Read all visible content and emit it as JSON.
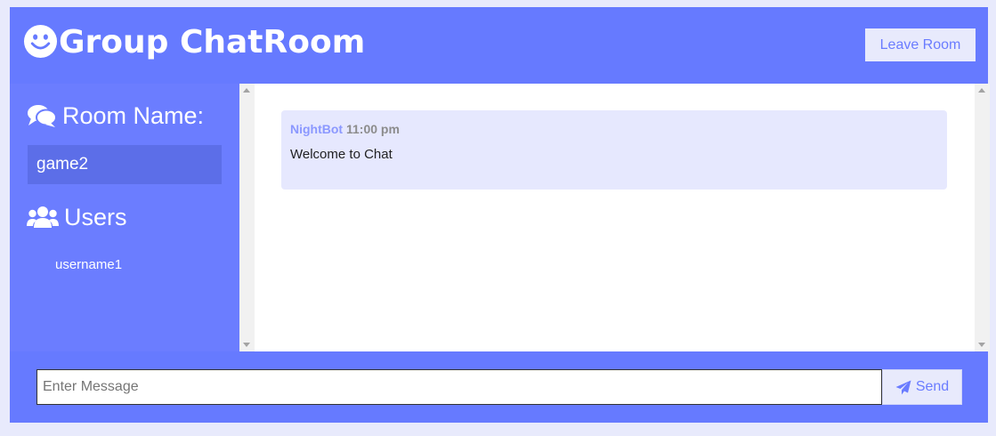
{
  "header": {
    "title": "Group ChatRoom",
    "logo_icon": "smile-icon",
    "leave_label": "Leave Room"
  },
  "sidebar": {
    "room_heading": "Room Name:",
    "room_icon": "comments-icon",
    "room_name": "game2",
    "users_heading": "Users",
    "users_icon": "users-icon",
    "users": [
      "username1"
    ]
  },
  "chat": {
    "messages": [
      {
        "author": "NightBot",
        "time": "11:00 pm",
        "text": "Welcome to Chat"
      }
    ]
  },
  "footer": {
    "input_placeholder": "Enter Message",
    "input_value": "",
    "send_label": "Send",
    "send_icon": "paper-plane-icon"
  },
  "colors": {
    "primary": "#667aff",
    "sidebar": "#6b7dff",
    "room_box": "#5c6ee8",
    "message_bg": "#e6e8fe",
    "page_bg": "#e8eafc",
    "author": "#8b98ff"
  }
}
